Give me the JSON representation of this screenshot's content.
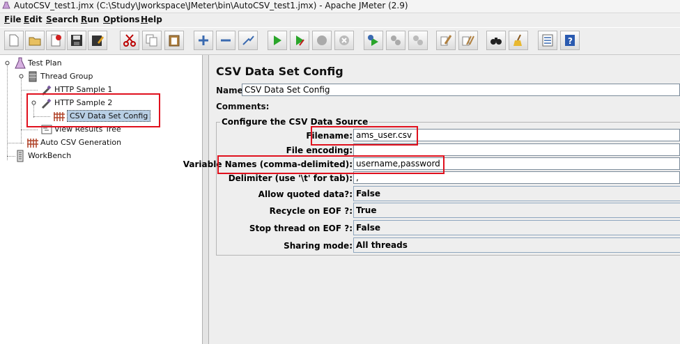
{
  "window": {
    "title": "AutoCSV_test1.jmx (C:\\Study\\Jworkspace\\JMeter\\bin\\AutoCSV_test1.jmx) - Apache JMeter (2.9)"
  },
  "menu": [
    {
      "label": "File",
      "accel": "F"
    },
    {
      "label": "Edit",
      "accel": "E"
    },
    {
      "label": "Search",
      "accel": "S"
    },
    {
      "label": "Run",
      "accel": "R"
    },
    {
      "label": "Options",
      "accel": "O"
    },
    {
      "label": "Help",
      "accel": "H"
    }
  ],
  "toolbar": {
    "icons": [
      "new-icon",
      "open-icon",
      "close-icon",
      "save-icon",
      "save-as-icon",
      "cut-icon",
      "copy-icon",
      "paste-icon",
      "expand-icon",
      "collapse-icon",
      "toggle-icon",
      "start-icon",
      "start-no-pause-icon",
      "stop-icon",
      "shutdown-icon",
      "remote-start-icon",
      "remote-stop-icon",
      "remote-shutdown-icon",
      "clear-icon",
      "clear-all-icon",
      "search-icon",
      "reset-search-icon",
      "function-helper-icon",
      "help-icon"
    ]
  },
  "tree": {
    "items": [
      {
        "label": "Test Plan"
      },
      {
        "label": "Thread Group"
      },
      {
        "label": "HTTP Sample 1"
      },
      {
        "label": "HTTP Sample 2"
      },
      {
        "label": "CSV Data Set Config"
      },
      {
        "label": "View Results Tree"
      },
      {
        "label": "Auto CSV Generation"
      },
      {
        "label": "WorkBench"
      }
    ]
  },
  "panel": {
    "title": "CSV Data Set Config",
    "name_label": "Name:",
    "name_value": "CSV Data Set Config",
    "comments_label": "Comments:",
    "group_title": "Configure the CSV Data Source",
    "fields": {
      "filename": {
        "label": "Filename:",
        "value": "ams_user.csv"
      },
      "encoding": {
        "label": "File encoding:",
        "value": ""
      },
      "varnames": {
        "label": "Variable Names (comma-delimited):",
        "value": "username,password"
      },
      "delimiter": {
        "label": "Delimiter (use '\\t' for tab):",
        "value": ","
      },
      "quoted": {
        "label": "Allow quoted data?:",
        "value": "False"
      },
      "recycle": {
        "label": "Recycle on EOF ?:",
        "value": "True"
      },
      "stopthread": {
        "label": "Stop thread on EOF ?:",
        "value": "False"
      },
      "sharing": {
        "label": "Sharing mode:",
        "value": "All threads"
      }
    }
  },
  "colors": {
    "highlight": "#e0101d",
    "selection": "#b8cfe5",
    "panel_bg": "#eeeeee"
  }
}
